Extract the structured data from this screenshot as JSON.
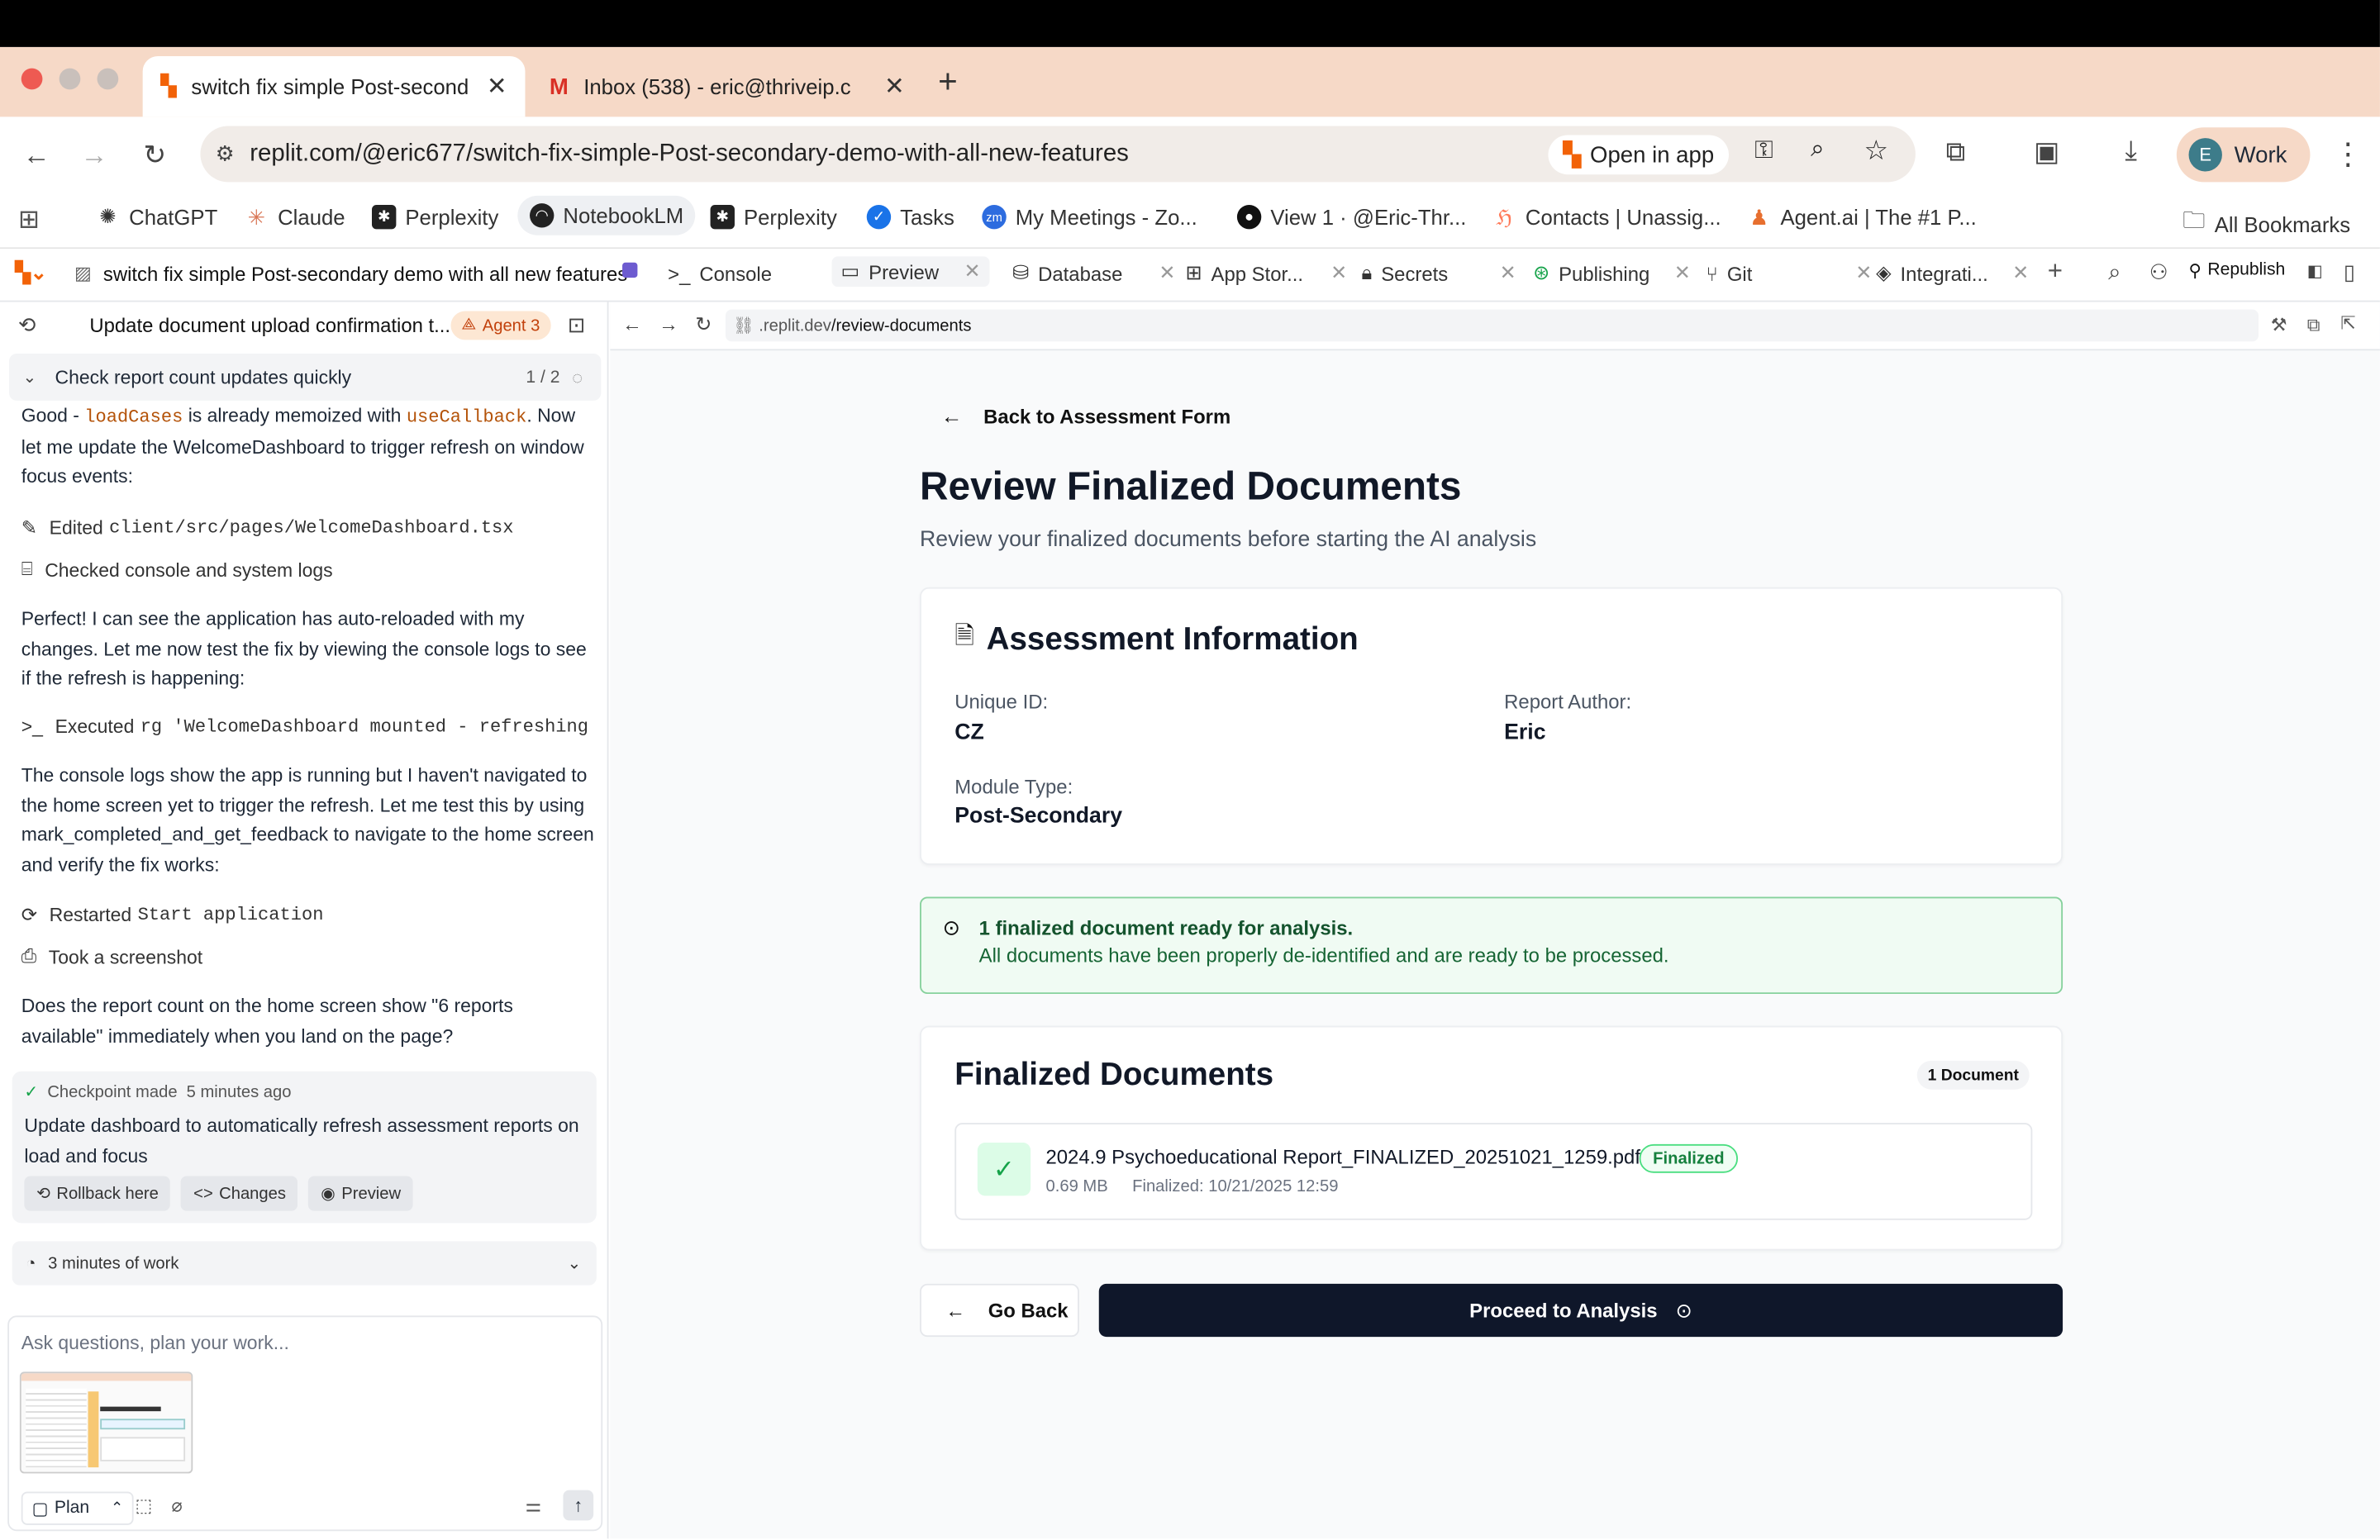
{
  "browser": {
    "tabs": [
      {
        "title": "switch fix simple Post-second"
      },
      {
        "title": "Inbox (538) - eric@thriveip.c"
      }
    ],
    "url_host": "replit.com",
    "url_path": "/@eric677/switch-fix-simple-Post-secondary-demo-with-all-new-features",
    "open_in_app": "Open in app",
    "profile_initial": "E",
    "profile_label": "Work"
  },
  "bookmarks": {
    "items": [
      "ChatGPT",
      "Claude",
      "Perplexity",
      "NotebookLM",
      "Perplexity",
      "Tasks",
      "My Meetings - Zo...",
      "View 1 · @Eric-Thr...",
      "Contacts | Unassig...",
      "Agent.ai | The #1 P..."
    ],
    "all": "All Bookmarks"
  },
  "replit": {
    "project_name": "switch fix simple Post-secondary demo with all new features",
    "tabs": [
      "Console",
      "Preview",
      "Database",
      "App Stor...",
      "Secrets",
      "Publishing",
      "Git",
      "Integrati..."
    ],
    "republish": "Republish"
  },
  "agent": {
    "thread_title": "Update document upload confirmation t...",
    "agent_badge": "Agent 3",
    "task_title": "Check report count updates quickly",
    "task_progress": "1 / 2",
    "m1_pre": "Good - ",
    "m1_code1": "loadCases",
    "m1_mid": " is already memoized with ",
    "m1_code2": "useCallback",
    "m1_post": ". Now let me update the WelcomeDashboard to trigger refresh on window focus events:",
    "a1_label": "Edited",
    "a1_code": "client/src/pages/WelcomeDashboard.tsx",
    "a2_label": "Checked console and system logs",
    "m2": "Perfect! I can see the application has auto-reloaded with my changes. Let me now test the fix by viewing the console logs to see if the refresh is happening:",
    "a3_label": "Executed",
    "a3_code": "rg 'WelcomeDashboard mounted - refreshing a…",
    "m3": "The console logs show the app is running but I haven't navigated to the home screen yet to trigger the refresh. Let me test this by using mark_completed_and_get_feedback to navigate to the home screen and verify the fix works:",
    "a4_label": "Restarted",
    "a4_code": "Start application",
    "a5_label": "Took a screenshot",
    "m4": "Does the report count on the home screen show \"6 reports available\" immediately when you land on the page?",
    "checkpoint_label": "Checkpoint made",
    "checkpoint_time": "5 minutes ago",
    "checkpoint_text": "Update dashboard to automatically refresh assessment reports on load and focus",
    "rollback": "Rollback here",
    "changes": "Changes",
    "preview": "Preview",
    "work_time": "3 minutes of work",
    "input_placeholder": "Ask questions, plan your work...",
    "plan": "Plan"
  },
  "preview": {
    "url_prefix": ".replit.dev",
    "url_path": "/review-documents",
    "back_link": "Back to Assessment Form",
    "title": "Review Finalized Documents",
    "subtitle": "Review your finalized documents before starting the AI analysis",
    "info": {
      "heading": "Assessment Information",
      "uid_label": "Unique ID:",
      "uid_value": "CZ",
      "author_label": "Report Author:",
      "author_value": "Eric",
      "module_label": "Module Type:",
      "module_value": "Post-Secondary"
    },
    "alert": {
      "title": "1 finalized document ready for analysis.",
      "body": "All documents have been properly de-identified and are ready to be processed."
    },
    "docs": {
      "heading": "Finalized Documents",
      "count_badge": "1 Document",
      "file_name": "2024.9 Psychoeducational Report_FINALIZED_20251021_1259.pdf",
      "status": "Finalized",
      "size": "0.69 MB",
      "finalized": "Finalized: 10/21/2025 12:59"
    },
    "go_back": "Go Back",
    "proceed": "Proceed to Analysis"
  },
  "colors": {
    "primary": "#0f172a",
    "success": "#16a34a",
    "agent_orange": "#c2410c",
    "tab_bar": "#f6d9c7"
  }
}
